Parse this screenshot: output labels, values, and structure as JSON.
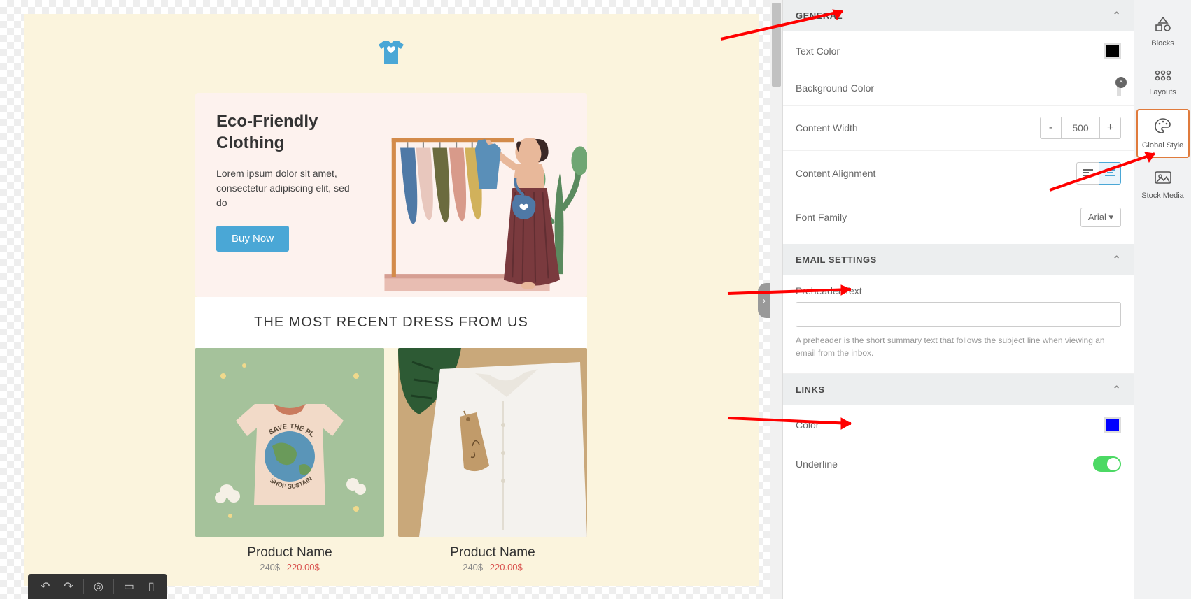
{
  "email": {
    "hero": {
      "title": "Eco-Friendly Clothing",
      "body": "Lorem ipsum dolor sit amet, consectetur adipiscing elit, sed do",
      "cta": "Buy Now"
    },
    "sectionTitle": "THE MOST RECENT DRESS FROM US",
    "products": [
      {
        "name": "Product Name",
        "oldPrice": "240$",
        "newPrice": "220.00$"
      },
      {
        "name": "Product Name",
        "oldPrice": "240$",
        "newPrice": "220.00$"
      }
    ]
  },
  "panel": {
    "general": {
      "header": "GENERAL",
      "textColor": {
        "label": "Text Color",
        "value": "#000000"
      },
      "bgColor": {
        "label": "Background Color",
        "value": "#fbf4dd"
      },
      "contentWidth": {
        "label": "Content Width",
        "value": "500"
      },
      "contentAlign": {
        "label": "Content Alignment",
        "value": "center"
      },
      "fontFamily": {
        "label": "Font Family",
        "value": "Arial"
      }
    },
    "emailSettings": {
      "header": "EMAIL SETTINGS",
      "preheader": {
        "label": "Preheader Text",
        "value": "",
        "hint": "A preheader is the short summary text that follows the subject line when viewing an email from the inbox."
      }
    },
    "links": {
      "header": "LINKS",
      "color": {
        "label": "Color",
        "value": "#0000ff"
      },
      "underline": {
        "label": "Underline",
        "value": true
      }
    }
  },
  "rightRail": {
    "blocks": "Blocks",
    "layouts": "Layouts",
    "globalStyle": "Global Style",
    "stockMedia": "Stock Media"
  }
}
